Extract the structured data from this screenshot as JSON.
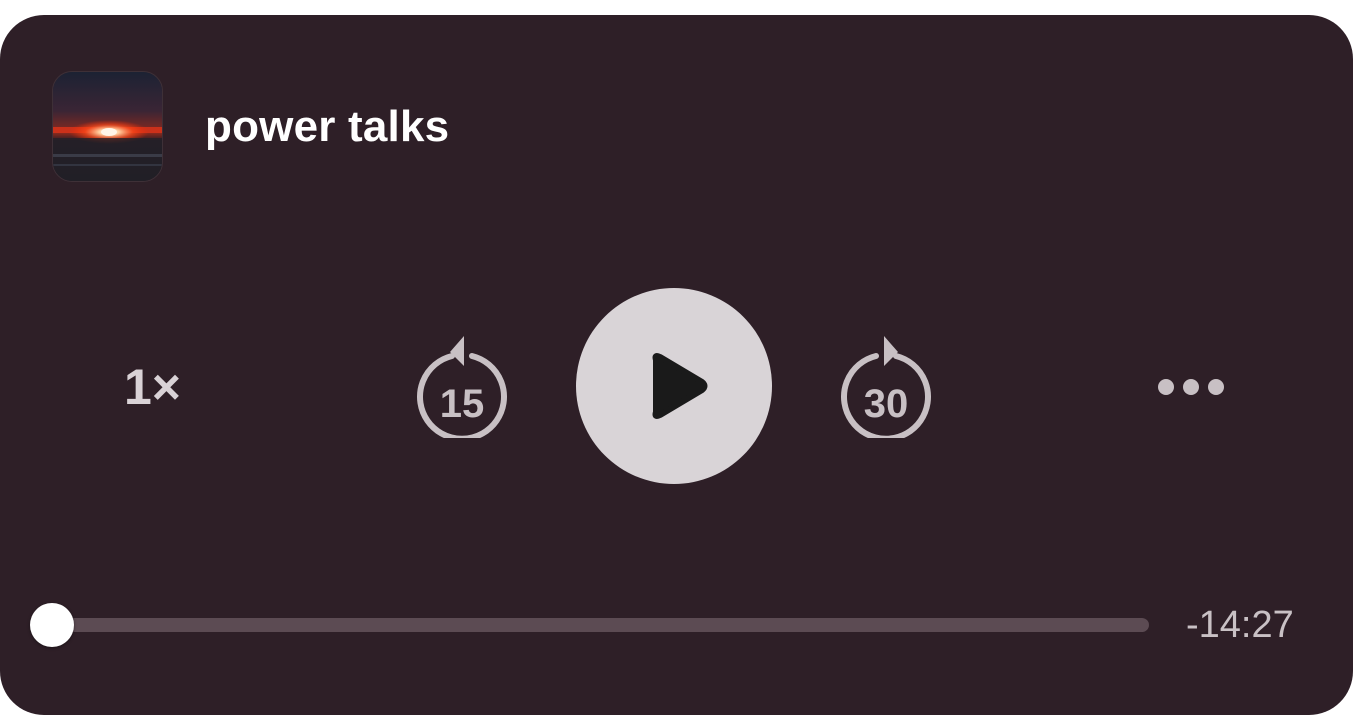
{
  "player": {
    "title": "power talks",
    "artwork_icon": "sunset-artwork-icon",
    "speed_label": "1×",
    "skip_back_label": "15",
    "skip_forward_label": "30",
    "play_icon": "play-icon",
    "more_icon": "more-dots-icon",
    "remaining_time": "-14:27",
    "progress_fraction": 0.01
  },
  "colors": {
    "card_background": "#2e1f27",
    "play_button": "#d9d4d7",
    "track": "#5c4b53",
    "thumb": "#ffffff"
  }
}
